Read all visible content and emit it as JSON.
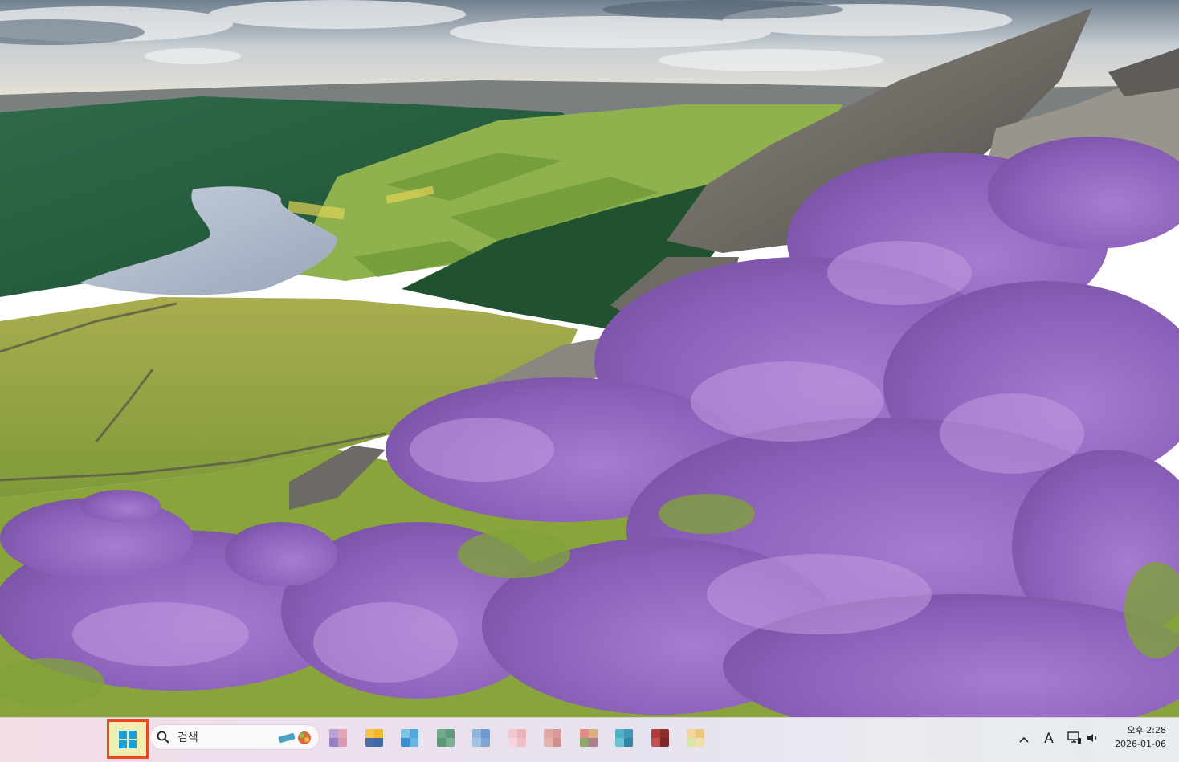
{
  "desktop": {
    "wallpaper": "moorland-heather-reservoir-landscape"
  },
  "taskbar": {
    "start": {
      "icon": "windows-logo-icon",
      "highlight_color": "#e8491d"
    },
    "search": {
      "icon": "search-icon",
      "placeholder": "검색",
      "decoration_icon": "search-highlight-icon"
    },
    "pinned_apps": [
      {
        "name": "app-1",
        "colors": [
          "#b9a2d3",
          "#e6a4b7",
          "#9a7fc4",
          "#d89ab1"
        ]
      },
      {
        "name": "app-2",
        "colors": [
          "#f4c542",
          "#f0b72f",
          "#4a6fa8",
          "#3f6aa3"
        ]
      },
      {
        "name": "app-3",
        "colors": [
          "#7ec3e8",
          "#53a8dd",
          "#3b8ed2",
          "#68b5e2"
        ]
      },
      {
        "name": "app-4",
        "colors": [
          "#6fa98a",
          "#5f9a7c",
          "#5c9877",
          "#78b092"
        ]
      },
      {
        "name": "app-5",
        "colors": [
          "#8fb5dd",
          "#6b9bd0",
          "#a4c2e3",
          "#7ba7d6"
        ]
      },
      {
        "name": "app-6",
        "colors": [
          "#f2c7cf",
          "#e9b5bf",
          "#f6d6dc",
          "#eec0c9"
        ]
      },
      {
        "name": "app-7",
        "colors": [
          "#e2a6a6",
          "#d59a9a",
          "#e5b1ae",
          "#cf8f8f"
        ]
      },
      {
        "name": "app-8",
        "colors": [
          "#e38a8a",
          "#d8b07a",
          "#8fa86a",
          "#b07a90"
        ]
      },
      {
        "name": "app-9",
        "colors": [
          "#4fb3c8",
          "#3d98b8",
          "#6ac2d4",
          "#2f86a9"
        ]
      },
      {
        "name": "app-10",
        "colors": [
          "#b03a3a",
          "#8f2d2d",
          "#c25252",
          "#7e2727"
        ]
      },
      {
        "name": "app-11",
        "colors": [
          "#f1d59a",
          "#e9c97f",
          "#d8e6a8",
          "#f3dfae"
        ]
      }
    ],
    "tray": {
      "overflow_icon": "chevron-up-icon",
      "ime_label": "A",
      "network_icon": "network-icon",
      "volume_icon": "volume-icon"
    },
    "clock": {
      "time": "오후 2:28",
      "date": "2026-01-06"
    }
  }
}
